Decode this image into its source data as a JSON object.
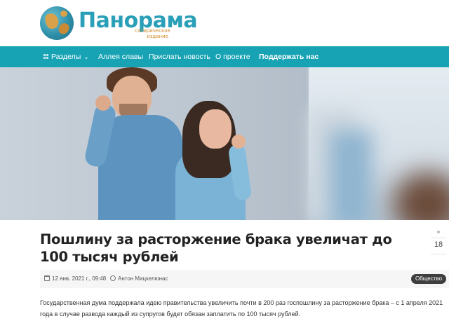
{
  "header": {
    "logo_title": "Панорама",
    "logo_subtitle": "сатирическое издание"
  },
  "nav": {
    "items": [
      {
        "label": "Разделы",
        "has_dropdown": true
      },
      {
        "label": "Аллея славы"
      },
      {
        "label": "Прислать новость"
      },
      {
        "label": "О проекте"
      },
      {
        "label": "Поддержать нас",
        "bold": true
      }
    ]
  },
  "article": {
    "title": "Пошлину за расторжение брака увеличат до 100 тысяч рублей",
    "date": "12 янв. 2021 г., 09:48",
    "author": "Антон Мицкелюнас",
    "category": "Общество",
    "share_count": "18",
    "lead": "Государственная дума поддержала идею правительства увеличить почти в 200 раз госпошлину за расторжение брака – с 1 апреля 2021 года в случае развода каждый из супругов будет обязан заплатить по 100 тысяч рублей."
  },
  "colors": {
    "nav_bg": "#17a3b4",
    "logo_text": "#2a9fb8",
    "logo_sub": "#d08a2a",
    "tag_bg": "#3e3e3e"
  },
  "icons": [
    "globe-logo-icon",
    "menu-grid-icon",
    "chevron-down-icon",
    "calendar-icon",
    "user-icon",
    "share-icon"
  ]
}
